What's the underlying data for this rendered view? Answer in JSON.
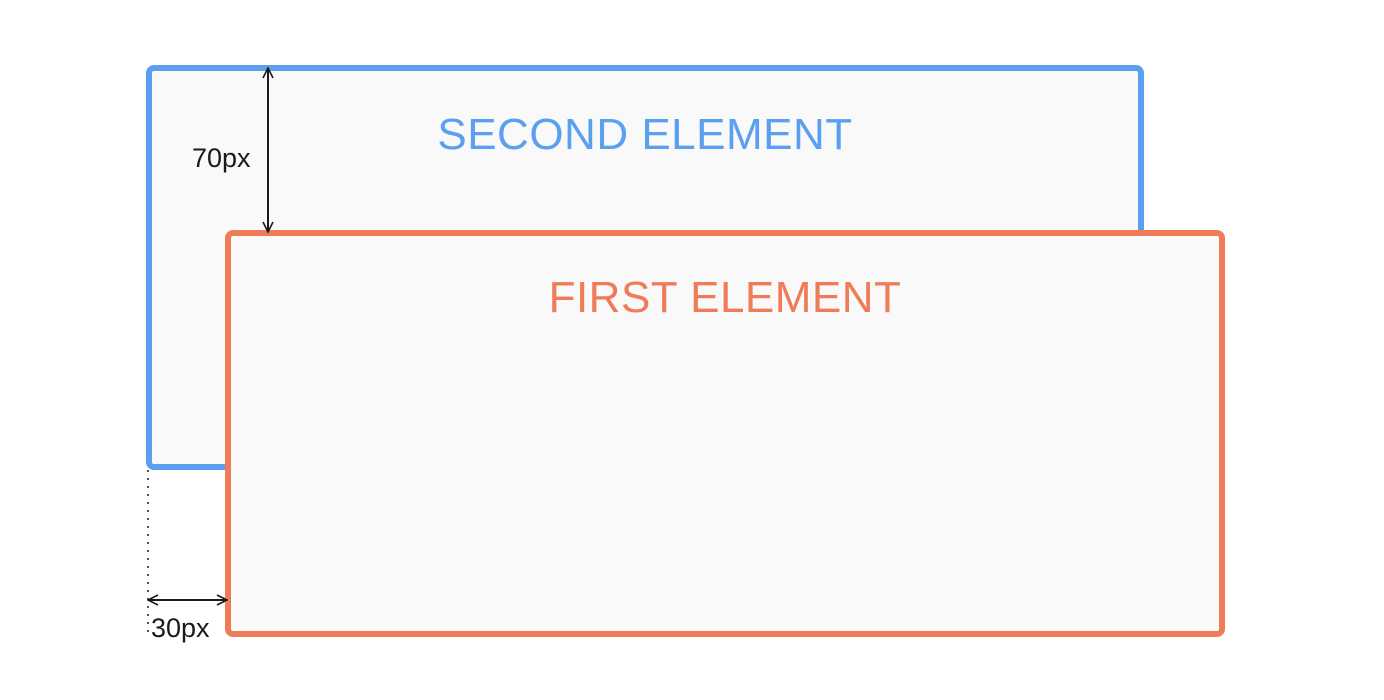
{
  "diagram": {
    "second_element": {
      "label": "SECOND ELEMENT",
      "border_color": "#5b9fef",
      "text_color": "#5b9fef",
      "fill_color": "#f9f9f9"
    },
    "first_element": {
      "label": "FIRST ELEMENT",
      "border_color": "#ee7c58",
      "text_color": "#ee7c58",
      "fill_color": "#f9f9f9"
    },
    "dimensions": {
      "vertical_offset": "70px",
      "horizontal_offset": "30px",
      "line_color": "#1a1a1a"
    }
  }
}
